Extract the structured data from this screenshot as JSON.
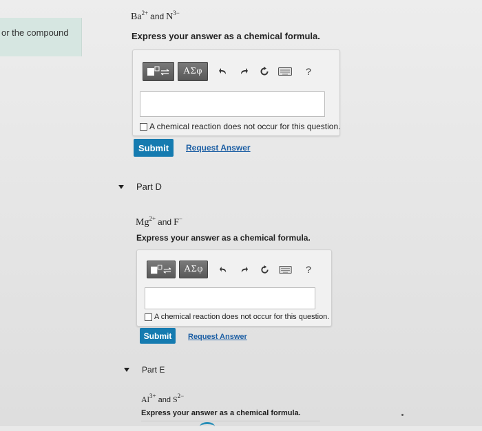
{
  "sidebar": {
    "fragment_text": "or the compound"
  },
  "part_c": {
    "ion1": "Ba",
    "ion1_charge": "2+",
    "joiner": "and",
    "ion2": "N",
    "ion2_charge": "3−",
    "prompt": "Express your answer as a chemical formula.",
    "greek_label": "ΑΣφ",
    "help_label": "?",
    "answer_value": "",
    "checkbox_label": "A chemical reaction does not occur for this question.",
    "submit_label": "Submit",
    "request_label": "Request Answer"
  },
  "part_d": {
    "title": "Part D",
    "ion1": "Mg",
    "ion1_charge": "2+",
    "joiner": "and",
    "ion2": "F",
    "ion2_charge": "−",
    "prompt": "Express your answer as a chemical formula.",
    "greek_label": "ΑΣφ",
    "help_label": "?",
    "answer_value": "",
    "checkbox_label": "A chemical reaction does not occur for this question.",
    "submit_label": "Submit",
    "request_label": "Request Answer"
  },
  "part_e": {
    "title": "Part E",
    "ion1": "Al",
    "ion1_charge": "3+",
    "joiner": "and",
    "ion2": "S",
    "ion2_charge": "2−",
    "prompt": "Express your answer as a chemical formula."
  }
}
